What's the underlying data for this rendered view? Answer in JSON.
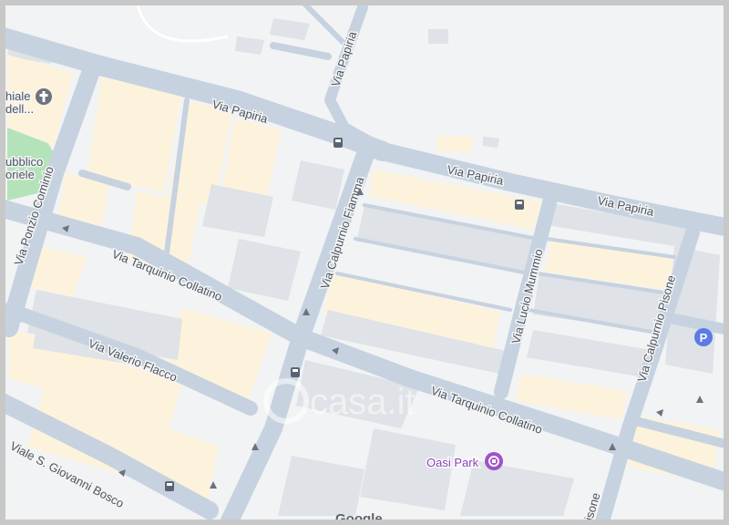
{
  "streets": {
    "via_papiria_1": "Via Papiria",
    "via_papiria_2": "Via Papiria",
    "via_papiria_3": "Via Papiria",
    "via_papiria_4": "Via Papiria",
    "via_ponzio_cominio": "Via Ponzio Cominio",
    "via_tarquinio_collatino_1": "Via Tarquinio Collatino",
    "via_tarquinio_collatino_2": "Via Tarquinio Collatino",
    "via_calpurnio_fiamma": "Via Calpurnio Fiamma",
    "via_lucio_mummio": "Via Lucio Mummio",
    "via_calpurnio_pisone": "Via Calpurnio Pisone",
    "via_valerio_flacco": "Via Valerio Flacco",
    "viale_s_giovanni_bosco": "Viale S. Giovanni Bosco",
    "pisone_fragment": "isone"
  },
  "places": {
    "cemetery_line1": "hiale",
    "cemetery_line2": "dell...",
    "park_line1": "ubblico",
    "park_line2": "oriele",
    "oasi_park": "Oasi Park"
  },
  "watermark": "casa.it",
  "google_logo": "Google",
  "icons": {
    "parking": "P"
  },
  "colors": {
    "road": "#c6d2df",
    "building_residential": "#fdf3dc",
    "building_other": "#dfe2e6",
    "park": "#b5e3b9",
    "poi_accent": "#a052c9",
    "parking_accent": "#5c7be6"
  }
}
